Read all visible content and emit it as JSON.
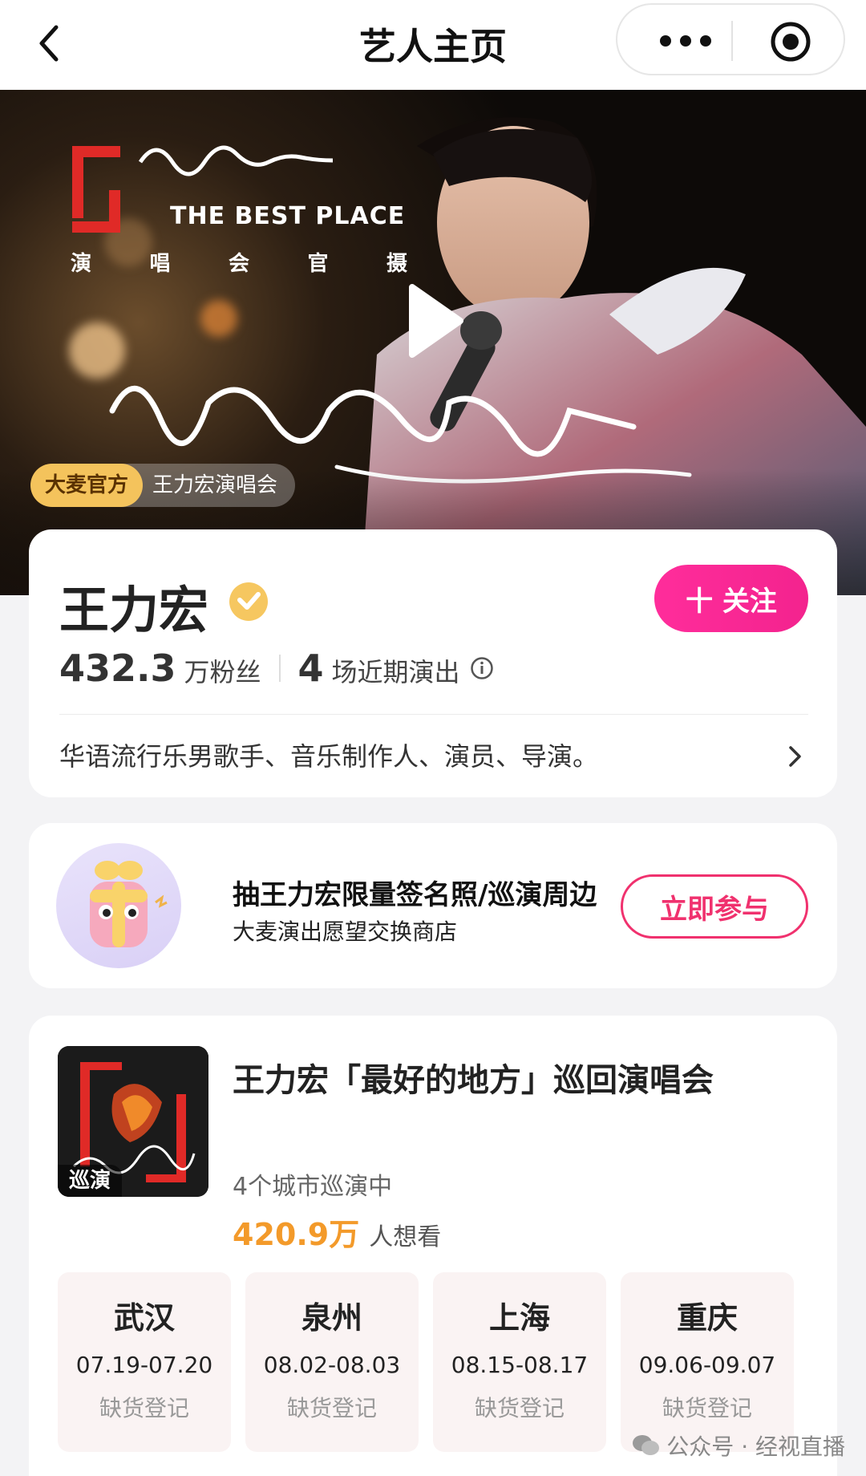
{
  "nav": {
    "title": "艺人主页"
  },
  "banner": {
    "logo_title": "THE BEST PLACE",
    "logo_subtitle": [
      "演",
      "唱",
      "会",
      "官",
      "摄"
    ],
    "tag_official": "大麦官方",
    "tag_name": "王力宏演唱会"
  },
  "artist": {
    "name": "王力宏",
    "follow_label": "十 关注",
    "fans_count": "432.3",
    "fans_unit": "万粉丝",
    "shows_count": "4",
    "shows_unit": "场近期演出",
    "description": "华语流行乐男歌手、音乐制作人、演员、导演。"
  },
  "promo": {
    "title": "抽王力宏限量签名照/巡演周边",
    "subtitle": "大麦演出愿望交换商店",
    "button_label": "立即参与"
  },
  "tour": {
    "badge": "巡演",
    "title": "王力宏「最好的地方」巡回演唱会",
    "cities_text": "4个城市巡演中",
    "want_count": "420.9万",
    "want_label": "人想看",
    "cities": [
      {
        "name": "武汉",
        "date": "07.19-07.20",
        "status": "缺货登记"
      },
      {
        "name": "泉州",
        "date": "08.02-08.03",
        "status": "缺货登记"
      },
      {
        "name": "上海",
        "date": "08.15-08.17",
        "status": "缺货登记"
      },
      {
        "name": "重庆",
        "date": "09.06-09.07",
        "status": "缺货登记"
      }
    ]
  },
  "watermark": "公众号 · 经视直播",
  "colors": {
    "accent_pink": "#f0316e",
    "follow_gradient": "#ff2d9b",
    "want_orange": "#f39a2a",
    "tag_gold": "#f4c35c"
  }
}
